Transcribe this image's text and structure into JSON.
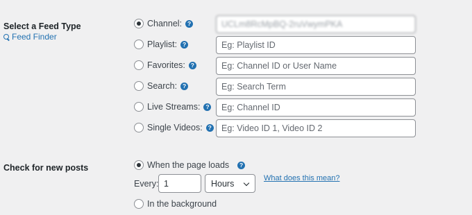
{
  "feed_type": {
    "heading": "Select a Feed Type",
    "finder_link": "Feed Finder",
    "options": [
      {
        "label": "Channel:",
        "value": "UCLm8RcMpBQ-2ruVwymPKA",
        "placeholder": "",
        "checked": true
      },
      {
        "label": "Playlist:",
        "value": "",
        "placeholder": "Eg: Playlist ID",
        "checked": false
      },
      {
        "label": "Favorites:",
        "value": "",
        "placeholder": "Eg: Channel ID or User Name",
        "checked": false
      },
      {
        "label": "Search:",
        "value": "",
        "placeholder": "Eg: Search Term",
        "checked": false
      },
      {
        "label": "Live Streams:",
        "value": "",
        "placeholder": "Eg: Channel ID",
        "checked": false
      },
      {
        "label": "Single Videos:",
        "value": "",
        "placeholder": "Eg: Video ID 1, Video ID 2",
        "checked": false
      }
    ]
  },
  "check_posts": {
    "heading": "Check for new posts",
    "option_page_loads": "When the page loads",
    "every_label": "Every:",
    "every_value": "1",
    "unit_selected": "Hours",
    "help_link": "What does this mean?",
    "option_background": "In the background"
  },
  "icons": {
    "help": "question-mark-circle-icon",
    "finder": "search-icon"
  },
  "colors": {
    "accent": "#2271b1",
    "background": "#f0f0f1"
  }
}
